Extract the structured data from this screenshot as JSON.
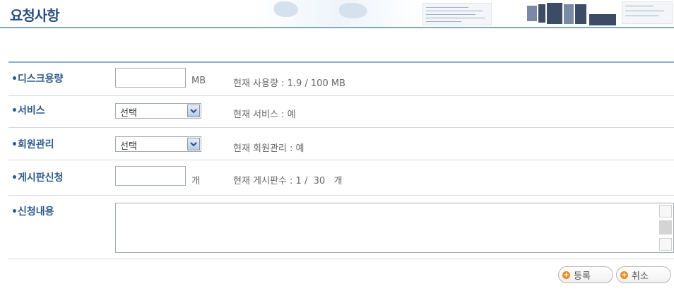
{
  "header": {
    "title": "요청사항"
  },
  "rows": [
    {
      "label": "•디스크용량",
      "unit": "MB",
      "info": "현재 사용량 : 1.9 / 100 MB"
    },
    {
      "label": "•서비스",
      "select_value": "선택",
      "info": "현재 서비스 : 예"
    },
    {
      "label": "•회원관리",
      "select_value": "선택",
      "info": "현재 회원관리 : 예"
    },
    {
      "label": "•게시판신청",
      "unit": "개",
      "info": "현재 게시판수 : 1 /  30   개"
    },
    {
      "label": "•신청내용"
    }
  ],
  "buttons": {
    "register": "등록",
    "cancel": "취소"
  },
  "icons": {
    "plus": "plus-circle-icon",
    "dropdown": "chevron-down-icon"
  },
  "colors": {
    "accent": "#2c5a8c",
    "button_icon": "#f08a1f",
    "rule": "#8db0cf"
  }
}
